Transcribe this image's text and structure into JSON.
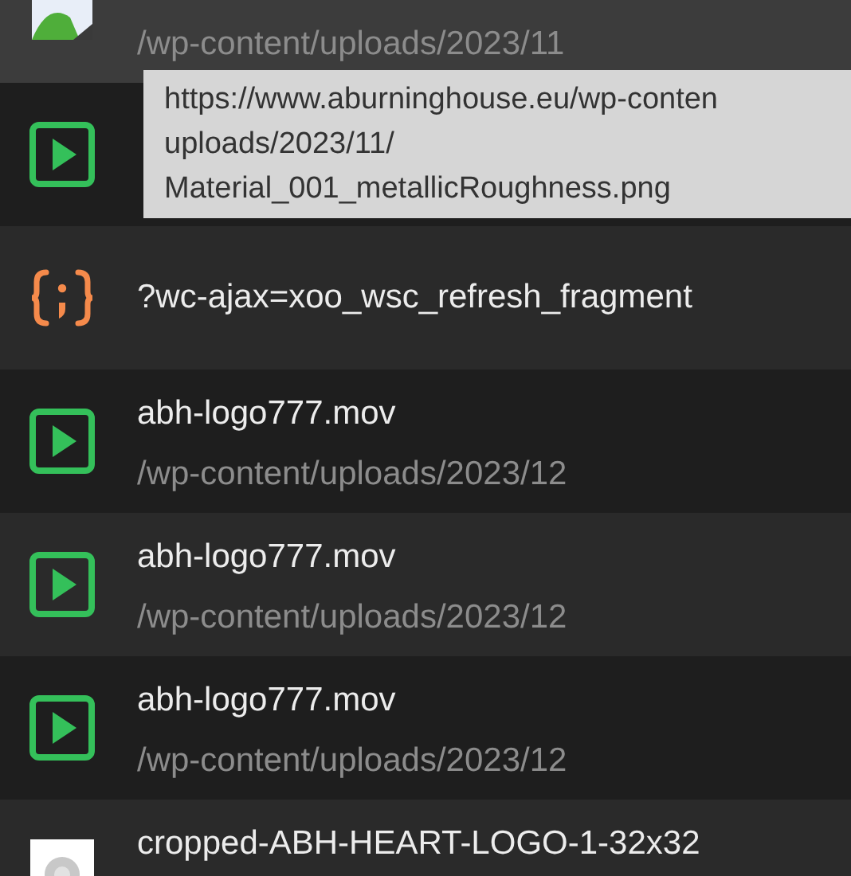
{
  "rows": [
    {
      "kind": "image",
      "selected": true,
      "path": "/wp-content/uploads/2023/11"
    },
    {
      "kind": "video",
      "selected": false
    },
    {
      "kind": "script",
      "selected": false,
      "name": "?wc-ajax=xoo_wsc_refresh_fragment"
    },
    {
      "kind": "video",
      "selected": false,
      "name": "abh-logo777.mov",
      "path": "/wp-content/uploads/2023/12"
    },
    {
      "kind": "video",
      "selected": false,
      "name": "abh-logo777.mov",
      "path": "/wp-content/uploads/2023/12"
    },
    {
      "kind": "video",
      "selected": false,
      "name": "abh-logo777.mov",
      "path": "/wp-content/uploads/2023/12"
    },
    {
      "kind": "thumbnail",
      "selected": false,
      "name": "cropped-ABH-HEART-LOGO-1-32x32"
    }
  ],
  "tooltip": {
    "lines": [
      "https://www.aburninghouse.eu/wp-conten",
      "uploads/2023/11/",
      "Material_001_metallicRoughness.png"
    ]
  }
}
